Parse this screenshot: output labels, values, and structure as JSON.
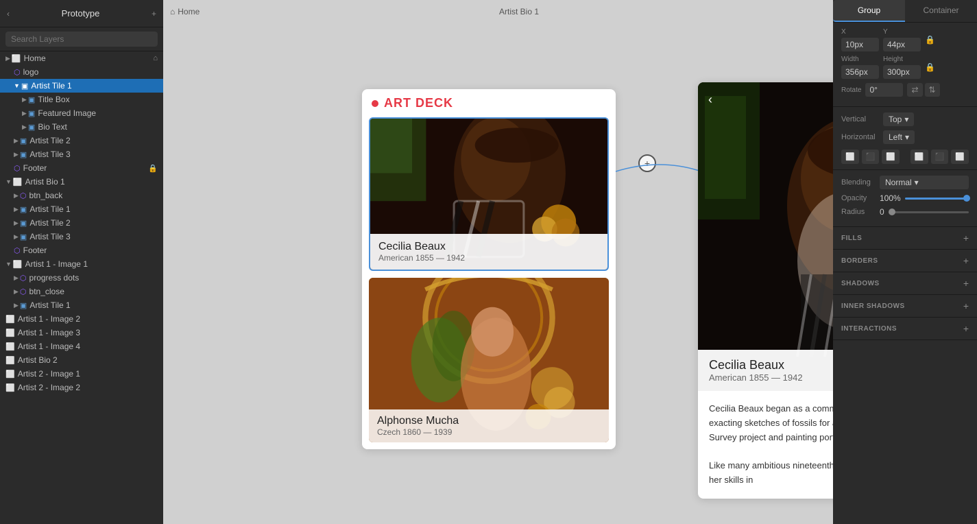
{
  "app": {
    "title": "Prototype",
    "add_icon": "+"
  },
  "left_panel": {
    "search_placeholder": "Search Layers",
    "layers": [
      {
        "id": "home",
        "label": "Home",
        "indent": 0,
        "type": "page",
        "has_home": true
      },
      {
        "id": "logo",
        "label": "logo",
        "indent": 1,
        "type": "component"
      },
      {
        "id": "artist-tile-1",
        "label": "Artist Tile 1",
        "indent": 1,
        "type": "group",
        "selected": true,
        "expanded": true
      },
      {
        "id": "title-box",
        "label": "Title Box",
        "indent": 2,
        "type": "group"
      },
      {
        "id": "featured-image",
        "label": "Featured Image",
        "indent": 2,
        "type": "group"
      },
      {
        "id": "bio-text",
        "label": "Bio Text",
        "indent": 2,
        "type": "group"
      },
      {
        "id": "artist-tile-2",
        "label": "Artist Tile 2",
        "indent": 1,
        "type": "group"
      },
      {
        "id": "artist-tile-3",
        "label": "Artist Tile 3",
        "indent": 1,
        "type": "group"
      },
      {
        "id": "footer-home",
        "label": "Footer",
        "indent": 1,
        "type": "component",
        "has_lock": true
      },
      {
        "id": "artist-bio-1",
        "label": "Artist Bio 1",
        "indent": 0,
        "type": "page"
      },
      {
        "id": "btn-back",
        "label": "btn_back",
        "indent": 1,
        "type": "component"
      },
      {
        "id": "artist-tile-1b",
        "label": "Artist Tile 1",
        "indent": 1,
        "type": "group"
      },
      {
        "id": "artist-tile-2b",
        "label": "Artist Tile 2",
        "indent": 1,
        "type": "group"
      },
      {
        "id": "artist-tile-3b",
        "label": "Artist Tile 3",
        "indent": 1,
        "type": "group"
      },
      {
        "id": "footer-bio",
        "label": "Footer",
        "indent": 1,
        "type": "component"
      },
      {
        "id": "artist-1-image-1",
        "label": "Artist 1 - Image 1",
        "indent": 0,
        "type": "page"
      },
      {
        "id": "progress-dots",
        "label": "progress dots",
        "indent": 1,
        "type": "component"
      },
      {
        "id": "btn-close",
        "label": "btn_close",
        "indent": 1,
        "type": "component"
      },
      {
        "id": "artist-tile-1c",
        "label": "Artist Tile 1",
        "indent": 1,
        "type": "group"
      },
      {
        "id": "artist-1-image-2",
        "label": "Artist 1 - Image 2",
        "indent": 0,
        "type": "page"
      },
      {
        "id": "artist-1-image-3",
        "label": "Artist 1 - Image 3",
        "indent": 0,
        "type": "page"
      },
      {
        "id": "artist-1-image-4",
        "label": "Artist 1 - Image 4",
        "indent": 0,
        "type": "page"
      },
      {
        "id": "artist-bio-2",
        "label": "Artist Bio 2",
        "indent": 0,
        "type": "page"
      },
      {
        "id": "artist-2-image-1",
        "label": "Artist 2 - Image 1",
        "indent": 0,
        "type": "page"
      },
      {
        "id": "artist-2-image-2",
        "label": "Artist 2 - Image 2",
        "indent": 0,
        "type": "page"
      }
    ]
  },
  "canvas": {
    "breadcrumb_home": "Home",
    "breadcrumb_bio": "Artist Bio 1",
    "art_deck_title": "ART DECK",
    "artist1_name": "Cecilia Beaux",
    "artist1_info": "American 1855 — 1942",
    "artist2_name": "Alphonse Mucha",
    "artist2_info": "Czech 1860 — 1939",
    "bio_name": "Cecilia Beaux",
    "bio_info": "American 1855 — 1942",
    "bio_text1": "Cecilia Beaux began as a commercial artist, making exacting sketches of fossils for a United States Geological Survey project and painting portraits on porcelain.",
    "bio_text2": "Like many ambitious nineteenth-century artists, she honed her skills in"
  },
  "right_panel": {
    "tab_group": "Group",
    "tab_container": "Container",
    "x_label": "X",
    "x_value": "10px",
    "y_label": "Y",
    "y_value": "44px",
    "width_label": "Width",
    "width_value": "356px",
    "height_label": "Height",
    "height_value": "300px",
    "rotate_label": "Rotate",
    "rotate_value": "0°",
    "vertical_label": "Vertical",
    "vertical_value": "Top",
    "horizontal_label": "Horizontal",
    "horizontal_value": "Left",
    "blending_label": "Blending",
    "blending_value": "Normal",
    "opacity_label": "Opacity",
    "opacity_value": "100%",
    "radius_label": "Radius",
    "radius_value": "0",
    "fills_label": "FILLS",
    "borders_label": "BORDERS",
    "shadows_label": "SHADOWS",
    "inner_shadows_label": "INNER SHADOWS",
    "interactions_label": "INTERACTIONS"
  }
}
